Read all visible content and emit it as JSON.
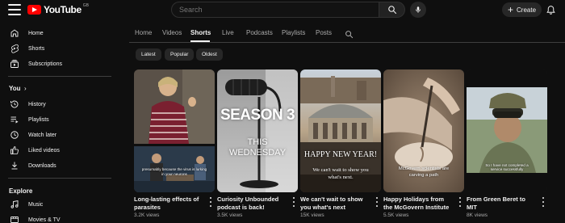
{
  "header": {
    "logo_text": "YouTube",
    "logo_superscript": "GB",
    "search_placeholder": "Search",
    "create_label": "Create"
  },
  "sidebar": {
    "main": [
      {
        "label": "Home",
        "icon": "home-icon"
      },
      {
        "label": "Shorts",
        "icon": "shorts-icon"
      },
      {
        "label": "Subscriptions",
        "icon": "subscriptions-icon"
      }
    ],
    "you_title": "You",
    "you_items": [
      {
        "label": "History",
        "icon": "history-icon"
      },
      {
        "label": "Playlists",
        "icon": "playlists-icon"
      },
      {
        "label": "Watch later",
        "icon": "watch-later-icon"
      },
      {
        "label": "Liked videos",
        "icon": "liked-videos-icon"
      },
      {
        "label": "Downloads",
        "icon": "downloads-icon"
      }
    ],
    "explore_title": "Explore",
    "explore_items": [
      {
        "label": "Music",
        "icon": "music-icon"
      },
      {
        "label": "Movies & TV",
        "icon": "movies-icon"
      }
    ]
  },
  "tabs": [
    "Home",
    "Videos",
    "Shorts",
    "Live",
    "Podcasts",
    "Playlists",
    "Posts"
  ],
  "active_tab": "Shorts",
  "chips": [
    "Latest",
    "Popular",
    "Oldest"
  ],
  "shorts": [
    {
      "title": "Long-lasting effects of parasites",
      "views": "3.2K views",
      "overlay_text": "presumably because the virus is lurking in your neurons"
    },
    {
      "title": "Curiosity Unbounded podcast is back!",
      "views": "3.5K views",
      "overlay_line1": "SEASON 3",
      "overlay_line2": "THIS",
      "overlay_line3": "WEDNESDAY"
    },
    {
      "title": "We can't wait to show you what's next",
      "views": "15K views",
      "overlay_line1": "HAPPY NEW YEAR!",
      "overlay_line2": "We can't wait to show you",
      "overlay_line3": "what's next."
    },
    {
      "title": "Happy Holidays from the McGovern Institute",
      "views": "5.5K views",
      "overlay_line1": "McGovern scientists are",
      "overlay_line2": "carving a path"
    },
    {
      "title": "From Green Beret to MIT",
      "views": "8K views",
      "overlay_text": "So I have not completed a service successfully"
    }
  ],
  "colors": {
    "background": "#0f0f0f",
    "brand_red": "#ff0000",
    "chip_bg": "#272727",
    "text_secondary": "#aaaaaa"
  }
}
